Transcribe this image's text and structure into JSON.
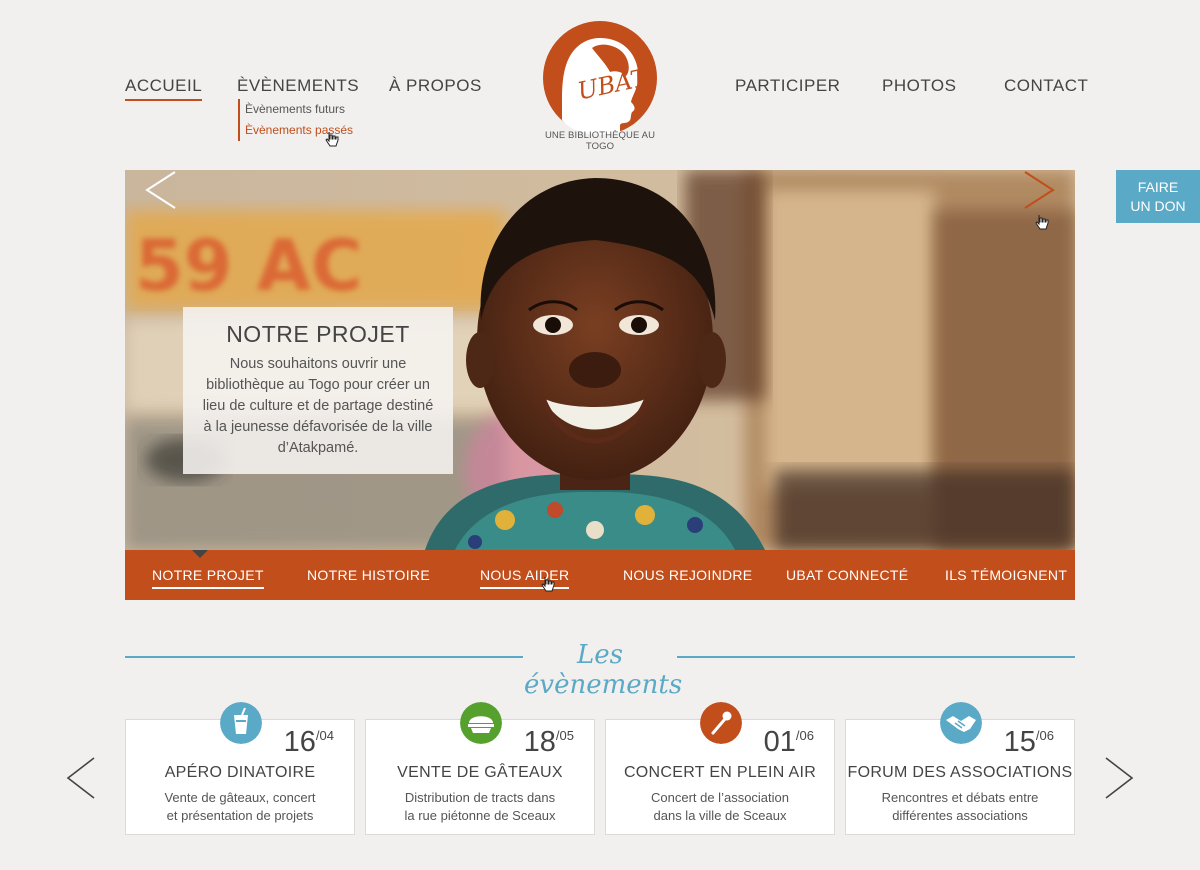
{
  "nav": {
    "left": [
      "ACCUEIL",
      "ÈVÈNEMENTS",
      "À PROPOS"
    ],
    "right": [
      "PARTICIPER",
      "PHOTOS",
      "CONTACT"
    ],
    "submenu": [
      "Èvènements futurs",
      "Èvènements passés"
    ]
  },
  "logo": {
    "text": "UBAT",
    "caption": "UNE BIBLIOTHÈQUE AU TOGO"
  },
  "donate": {
    "line1": "FAIRE",
    "line2": "UN DON"
  },
  "hero": {
    "caption_title": "NOTRE PROJET",
    "caption_text": "Nous souhaitons ouvrir une bibliothèque au Togo pour créer un lieu de culture et de partage destiné à la jeunesse défavorisée de la ville d’Atakpamé.",
    "bg_sign_text": "59 AC"
  },
  "tabs": [
    "NOTRE PROJET",
    "NOTRE HISTOIRE",
    "NOUS AIDER",
    "NOUS REJOINDRE",
    "UBAT CONNECTÉ",
    "ILS TÉMOIGNENT"
  ],
  "events_title": "Les évènements",
  "events": [
    {
      "day": "16",
      "month": "/04",
      "title": "APÉRO DINATOIRE",
      "line1": "Vente de gâteaux, concert",
      "line2": "et présentation de projets",
      "icon": "drink-icon",
      "color": "#5aa9c6"
    },
    {
      "day": "18",
      "month": "/05",
      "title": "VENTE DE GÂTEAUX",
      "line1": "Distribution de tracts dans",
      "line2": "la rue piétonne de Sceaux",
      "icon": "cake-icon",
      "color": "#56a02e"
    },
    {
      "day": "01",
      "month": "/06",
      "title": "CONCERT EN PLEIN AIR",
      "line1": "Concert de l’association",
      "line2": "dans la ville de Sceaux",
      "icon": "microphone-icon",
      "color": "#c14e1b"
    },
    {
      "day": "15",
      "month": "/06",
      "title": "FORUM DES ASSOCIATIONS",
      "line1": "Rencontres et débats entre",
      "line2": "différentes associations",
      "icon": "handshake-icon",
      "color": "#5aa9c6"
    }
  ],
  "colors": {
    "accent": "#c14e1b",
    "blue": "#5aa9c6",
    "green": "#56a02e",
    "background": "#f1f0ee"
  }
}
